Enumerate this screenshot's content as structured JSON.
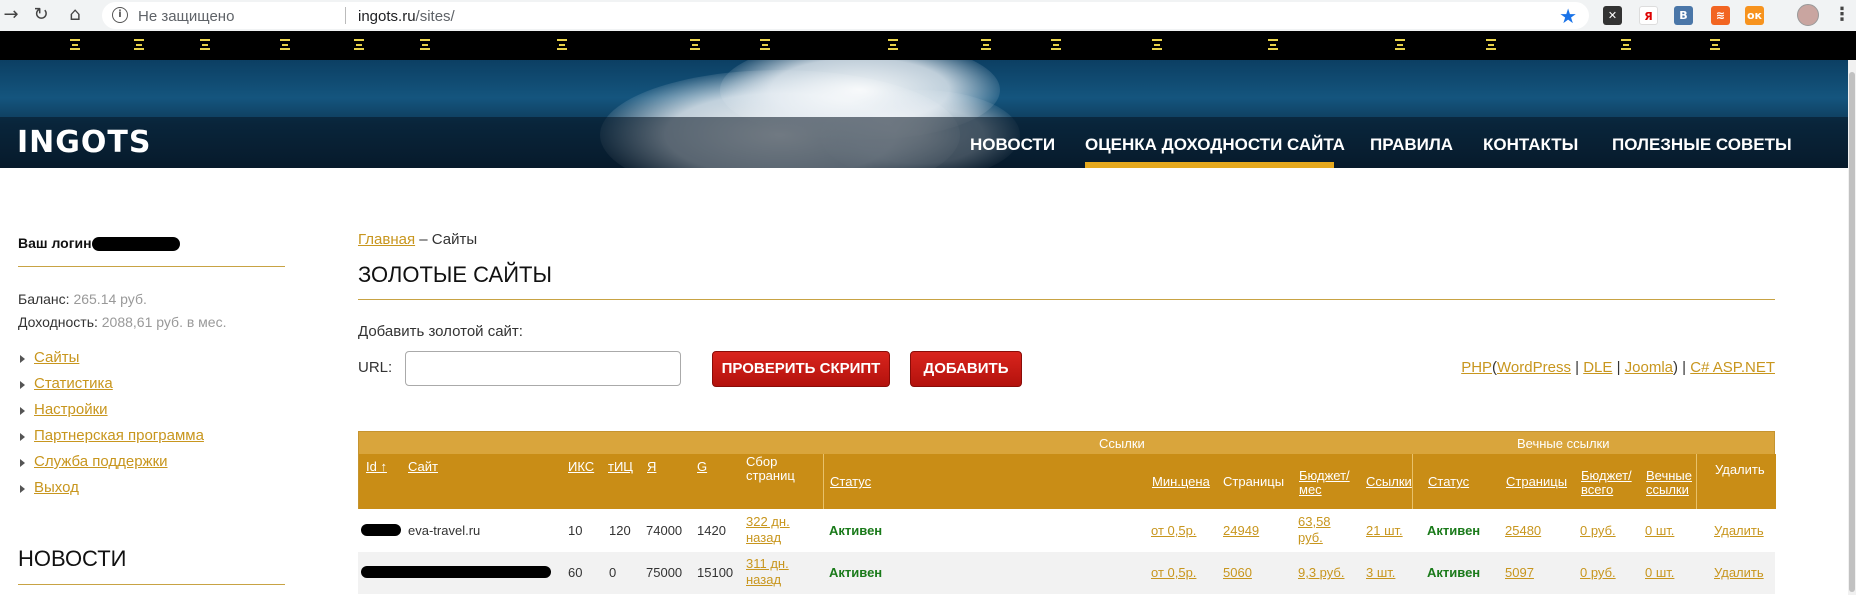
{
  "browser": {
    "insecure_label": "Не защищено",
    "url_host": "ingots.ru",
    "url_path": "/sites/"
  },
  "header": {
    "logo": "INGOTS",
    "nav": [
      {
        "label": "НОВОСТИ"
      },
      {
        "label": "ОЦЕНКА ДОХОДНОСТИ САЙТА",
        "active": true
      },
      {
        "label": "ПРАВИЛА"
      },
      {
        "label": "КОНТАКТЫ"
      },
      {
        "label": "ПОЛЕЗНЫЕ СОВЕТЫ"
      }
    ],
    "accent_color": "#e5a81d"
  },
  "sidebar": {
    "login_label": "Ваш логин",
    "balance_label": "Баланс:",
    "balance_value": "265.14 руб.",
    "income_label": "Доходность:",
    "income_value": "2088,61 руб. в мес.",
    "menu": [
      "Сайты",
      "Статистика",
      "Настройки",
      "Партнерская программа",
      "Служба поддержки",
      "Выход"
    ],
    "news_title": "НОВОСТИ"
  },
  "main": {
    "breadcrumb_home": "Главная",
    "breadcrumb_current": "– Сайты",
    "title": "ЗОЛОТЫЕ САЙТЫ",
    "add_label": "Добавить золотой сайт:",
    "url_label": "URL:",
    "url_value": "",
    "check_button": "ПРОВЕРИТЬ СКРИПТ",
    "add_button": "ДОБАВИТЬ",
    "cms": {
      "php": "PHP",
      "open": "(",
      "wordpress": "WordPress",
      "sep1": "|",
      "dle": "DLE",
      "sep2": "|",
      "joomla": "Joomla",
      "close": ") |",
      "csharp": "C# ASP.NET"
    }
  },
  "table": {
    "group_links": "Ссылки",
    "group_eternal": "Вечные ссылки",
    "columns": {
      "id": "Id ↑",
      "site": "Сайт",
      "iks": "ИКС",
      "tic": "тИЦ",
      "ya": "Я",
      "g": "G",
      "collect": "Сбор\nстраниц",
      "status": "Статус",
      "min_price": "Мин.цена",
      "pages": "Страницы",
      "budget": "Бюджет/\nмес",
      "links": "Ссылки",
      "e_status": "Статус",
      "e_pages": "Страницы",
      "e_budget": "Бюджет/\nвсего",
      "e_links": "Вечные\nссылки",
      "delete": "Удалить"
    },
    "rows": [
      {
        "site": "eva-travel.ru",
        "iks": "10",
        "tic": "120",
        "ya": "74000",
        "g": "1420",
        "collect": "322 дн.\nназад",
        "status": "Активен",
        "min_price": "от 0,5р.",
        "pages": "24949",
        "budget": "63,58\nруб.",
        "links": "21 шт.",
        "e_status": "Активен",
        "e_pages": "25480",
        "e_budget": "0 руб.",
        "e_links": "0 шт.",
        "delete": "Удалить"
      },
      {
        "site": "",
        "iks": "60",
        "tic": "0",
        "ya": "75000",
        "g": "15100",
        "collect": "311 дн.\nназад",
        "status": "Активен",
        "min_price": "от 0,5р.",
        "pages": "5060",
        "budget": "9,3 руб.",
        "links": "3 шт.",
        "e_status": "Активен",
        "e_pages": "5097",
        "e_budget": "0 руб.",
        "e_links": "0 шт.",
        "delete": "Удалить"
      }
    ]
  }
}
